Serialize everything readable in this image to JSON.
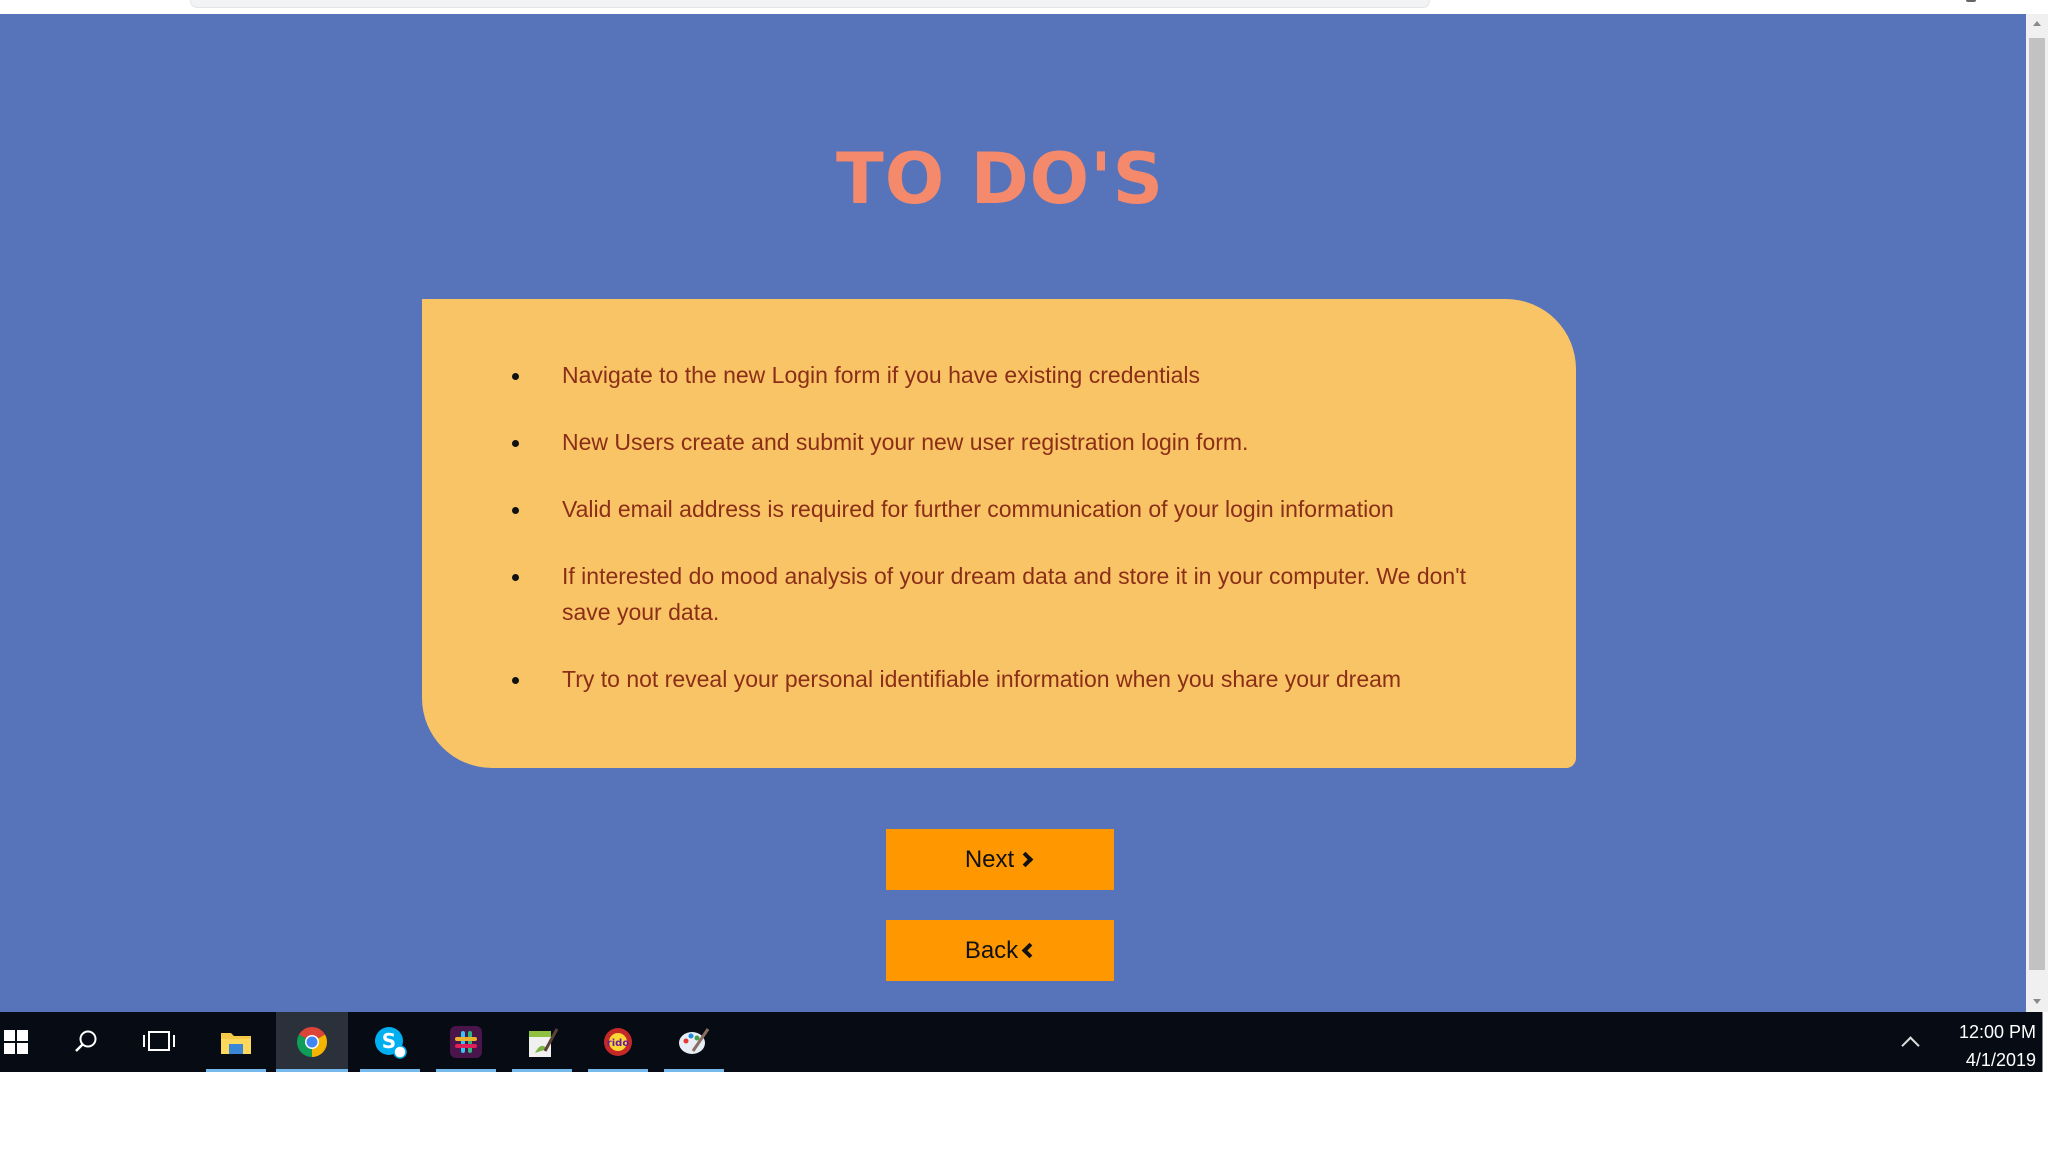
{
  "page": {
    "title": "TO DO'S",
    "todos": [
      "Navigate to the new Login form if you have existing credentials",
      "New Users create and submit your new user registration login form.",
      "Valid email address is required for further communication of your login information",
      "If interested do mood analysis of your dream data and store it in your computer. We don't save your data.",
      "Try to not reveal your personal identifiable information when you share your dream"
    ],
    "next_label": "Next",
    "back_label": "Back"
  },
  "colors": {
    "background": "#5774ba",
    "title": "#f4896b",
    "card": "#f9c466",
    "card_text": "#8b2e18",
    "button": "#ff9800",
    "taskbar": "#060b14"
  },
  "taskbar": {
    "icons": [
      "windows-start-icon",
      "search-icon",
      "task-view-icon",
      "file-explorer-icon",
      "chrome-icon",
      "skype-icon",
      "slack-icon",
      "notepad-plus-icon",
      "rido-icon",
      "paint-icon"
    ],
    "clock_time": "12:00 PM",
    "clock_date": "4/1/2019"
  }
}
